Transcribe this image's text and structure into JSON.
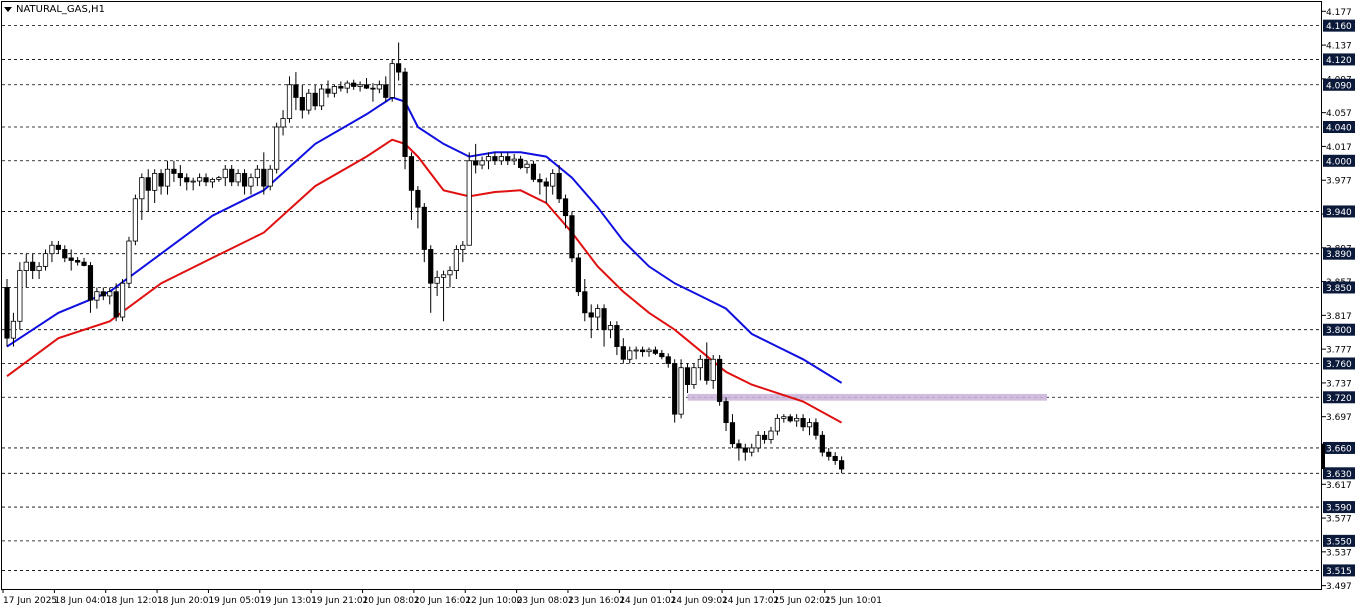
{
  "chart_data": {
    "type": "candlestick",
    "title": "NATURAL_GAS,H1",
    "ylim": [
      3.493,
      4.188
    ],
    "y_ticks": [
      "4.177",
      "4.137",
      "4.097",
      "4.057",
      "4.017",
      "3.977",
      "3.937",
      "3.897",
      "3.857",
      "3.817",
      "3.777",
      "3.737",
      "3.697",
      "3.657",
      "3.617",
      "3.577",
      "3.537",
      "3.497"
    ],
    "level_lines": [
      {
        "value": 4.16,
        "label": "4.160"
      },
      {
        "value": 4.12,
        "label": "4.120"
      },
      {
        "value": 4.09,
        "label": "4.090"
      },
      {
        "value": 4.04,
        "label": "4.040"
      },
      {
        "value": 4.0,
        "label": "4.000"
      },
      {
        "value": 3.94,
        "label": "3.940"
      },
      {
        "value": 3.89,
        "label": "3.890"
      },
      {
        "value": 3.85,
        "label": "3.850"
      },
      {
        "value": 3.8,
        "label": "3.800"
      },
      {
        "value": 3.76,
        "label": "3.760"
      },
      {
        "value": 3.72,
        "label": "3.720"
      },
      {
        "value": 3.66,
        "label": "3.660"
      },
      {
        "value": 3.63,
        "label": "3.630"
      },
      {
        "value": 3.59,
        "label": "3.590"
      },
      {
        "value": 3.55,
        "label": "3.550"
      },
      {
        "value": 3.515,
        "label": "3.515"
      }
    ],
    "zone": {
      "from": 3.716,
      "to": 3.724,
      "x_start": 106,
      "x_end": 162,
      "color": "#c9b3d9"
    },
    "x_labels": [
      {
        "i": 0,
        "label": "17 Jun 2025"
      },
      {
        "i": 8,
        "label": "18 Jun 04:01"
      },
      {
        "i": 16,
        "label": "18 Jun 12:01"
      },
      {
        "i": 24,
        "label": "18 Jun 20:01"
      },
      {
        "i": 32,
        "label": "19 Jun 05:01"
      },
      {
        "i": 40,
        "label": "19 Jun 13:01"
      },
      {
        "i": 48,
        "label": "19 Jun 21:01"
      },
      {
        "i": 56,
        "label": "20 Jun 08:01"
      },
      {
        "i": 64,
        "label": "20 Jun 16:01"
      },
      {
        "i": 72,
        "label": "22 Jun 10:00"
      },
      {
        "i": 80,
        "label": "23 Jun 08:01"
      },
      {
        "i": 88,
        "label": "23 Jun 16:01"
      },
      {
        "i": 96,
        "label": "24 Jun 01:01"
      },
      {
        "i": 104,
        "label": "24 Jun 09:01"
      },
      {
        "i": 112,
        "label": "24 Jun 17:01"
      },
      {
        "i": 120,
        "label": "25 Jun 02:01"
      },
      {
        "i": 128,
        "label": "25 Jun 10:01"
      }
    ],
    "candles": [
      [
        3.85,
        3.86,
        3.78,
        3.79
      ],
      [
        3.79,
        3.82,
        3.78,
        3.81
      ],
      [
        3.81,
        3.88,
        3.8,
        3.87
      ],
      [
        3.87,
        3.89,
        3.85,
        3.88
      ],
      [
        3.88,
        3.89,
        3.86,
        3.87
      ],
      [
        3.87,
        3.88,
        3.86,
        3.875
      ],
      [
        3.875,
        3.895,
        3.87,
        3.89
      ],
      [
        3.89,
        3.905,
        3.88,
        3.9
      ],
      [
        3.9,
        3.905,
        3.89,
        3.895
      ],
      [
        3.895,
        3.9,
        3.88,
        3.885
      ],
      [
        3.885,
        3.895,
        3.87,
        3.882
      ],
      [
        3.882,
        3.886,
        3.876,
        3.88
      ],
      [
        3.88,
        3.885,
        3.875,
        3.876
      ],
      [
        3.876,
        3.88,
        3.82,
        3.835
      ],
      [
        3.835,
        3.85,
        3.825,
        3.845
      ],
      [
        3.845,
        3.85,
        3.835,
        3.84
      ],
      [
        3.84,
        3.85,
        3.83,
        3.845
      ],
      [
        3.845,
        3.855,
        3.81,
        3.815
      ],
      [
        3.815,
        3.86,
        3.81,
        3.855
      ],
      [
        3.855,
        3.91,
        3.85,
        3.905
      ],
      [
        3.905,
        3.96,
        3.9,
        3.955
      ],
      [
        3.955,
        3.985,
        3.93,
        3.98
      ],
      [
        3.98,
        3.99,
        3.94,
        3.965
      ],
      [
        3.965,
        3.99,
        3.95,
        3.985
      ],
      [
        3.985,
        3.99,
        3.96,
        3.97
      ],
      [
        3.97,
        4,
        3.96,
        3.99
      ],
      [
        3.99,
        4,
        3.975,
        3.985
      ],
      [
        3.985,
        3.995,
        3.97,
        3.98
      ],
      [
        3.98,
        3.985,
        3.965,
        3.975
      ],
      [
        3.975,
        3.98,
        3.965,
        3.976
      ],
      [
        3.976,
        3.985,
        3.97,
        3.98
      ],
      [
        3.98,
        3.985,
        3.97,
        3.975
      ],
      [
        3.975,
        3.98,
        3.968,
        3.978
      ],
      [
        3.978,
        3.982,
        3.975,
        3.98
      ],
      [
        3.98,
        3.995,
        3.97,
        3.99
      ],
      [
        3.99,
        3.995,
        3.97,
        3.975
      ],
      [
        3.975,
        3.99,
        3.97,
        3.985
      ],
      [
        3.985,
        3.99,
        3.96,
        3.97
      ],
      [
        3.97,
        3.985,
        3.96,
        3.98
      ],
      [
        3.98,
        3.995,
        3.97,
        3.99
      ],
      [
        3.99,
        4.01,
        3.96,
        3.97
      ],
      [
        3.97,
        3.995,
        3.965,
        3.99
      ],
      [
        3.99,
        4.045,
        3.985,
        4.04
      ],
      [
        4.04,
        4.06,
        4.03,
        4.05
      ],
      [
        4.05,
        4.1,
        4.045,
        4.09
      ],
      [
        4.09,
        4.105,
        4.06,
        4.075
      ],
      [
        4.075,
        4.09,
        4.05,
        4.06
      ],
      [
        4.06,
        4.085,
        4.055,
        4.08
      ],
      [
        4.08,
        4.09,
        4.06,
        4.065
      ],
      [
        4.065,
        4.09,
        4.06,
        4.085
      ],
      [
        4.085,
        4.095,
        4.075,
        4.08
      ],
      [
        4.08,
        4.09,
        4.075,
        4.088
      ],
      [
        4.088,
        4.094,
        4.082,
        4.086
      ],
      [
        4.086,
        4.095,
        4.08,
        4.092
      ],
      [
        4.092,
        4.096,
        4.084,
        4.088
      ],
      [
        4.088,
        4.094,
        4.082,
        4.09
      ],
      [
        4.09,
        4.098,
        4.085,
        4.086
      ],
      [
        4.086,
        4.092,
        4.07,
        4.085
      ],
      [
        4.085,
        4.095,
        4.08,
        4.09
      ],
      [
        4.09,
        4.1,
        4.07,
        4.075
      ],
      [
        4.075,
        4.12,
        4.07,
        4.115
      ],
      [
        4.115,
        4.14,
        4.095,
        4.105
      ],
      [
        4.105,
        4.11,
        3.99,
        4.005
      ],
      [
        4.005,
        4.01,
        3.93,
        3.965
      ],
      [
        3.965,
        3.97,
        3.92,
        3.945
      ],
      [
        3.945,
        3.95,
        3.88,
        3.895
      ],
      [
        3.895,
        3.9,
        3.82,
        3.855
      ],
      [
        3.855,
        3.87,
        3.84,
        3.862
      ],
      [
        3.862,
        3.87,
        3.81,
        3.865
      ],
      [
        3.865,
        3.875,
        3.85,
        3.87
      ],
      [
        3.87,
        3.9,
        3.86,
        3.895
      ],
      [
        3.895,
        3.905,
        3.88,
        3.9
      ],
      [
        3.9,
        4.01,
        3.98,
        4.0
      ],
      [
        4.0,
        4.02,
        3.985,
        3.995
      ],
      [
        3.995,
        4.005,
        3.99,
        4.0
      ],
      [
        4.0,
        4.01,
        3.99,
        4.005
      ],
      [
        4.005,
        4.01,
        3.995,
        4.0
      ],
      [
        4.0,
        4.01,
        3.995,
        4.005
      ],
      [
        4.005,
        4.01,
        3.995,
        4.0
      ],
      [
        4.0,
        4.008,
        3.995,
        4.002
      ],
      [
        4.002,
        4.006,
        3.99,
        3.992
      ],
      [
        3.992,
        4.0,
        3.985,
        3.996
      ],
      [
        3.996,
        4.0,
        3.975,
        3.978
      ],
      [
        3.978,
        3.985,
        3.96,
        3.975
      ],
      [
        3.975,
        3.98,
        3.95,
        3.97
      ],
      [
        3.97,
        3.99,
        3.96,
        3.985
      ],
      [
        3.985,
        3.995,
        3.95,
        3.955
      ],
      [
        3.955,
        3.96,
        3.92,
        3.935
      ],
      [
        3.935,
        3.94,
        3.88,
        3.885
      ],
      [
        3.885,
        3.89,
        3.84,
        3.845
      ],
      [
        3.845,
        3.86,
        3.81,
        3.82
      ],
      [
        3.82,
        3.83,
        3.79,
        3.815
      ],
      [
        3.815,
        3.83,
        3.8,
        3.825
      ],
      [
        3.825,
        3.83,
        3.78,
        3.8
      ],
      [
        3.8,
        3.81,
        3.79,
        3.805
      ],
      [
        3.805,
        3.81,
        3.77,
        3.78
      ],
      [
        3.78,
        3.79,
        3.76,
        3.765
      ],
      [
        3.765,
        3.78,
        3.76,
        3.775
      ],
      [
        3.775,
        3.78,
        3.765,
        3.776
      ],
      [
        3.776,
        3.78,
        3.768,
        3.774
      ],
      [
        3.774,
        3.779,
        3.768,
        3.776
      ],
      [
        3.776,
        3.78,
        3.77,
        3.772
      ],
      [
        3.772,
        3.776,
        3.765,
        3.768
      ],
      [
        3.768,
        3.772,
        3.755,
        3.76
      ],
      [
        3.76,
        3.765,
        3.69,
        3.7
      ],
      [
        3.7,
        3.765,
        3.695,
        3.755
      ],
      [
        3.755,
        3.76,
        3.725,
        3.735
      ],
      [
        3.735,
        3.76,
        3.73,
        3.755
      ],
      [
        3.755,
        3.77,
        3.74,
        3.765
      ],
      [
        3.765,
        3.785,
        3.735,
        3.74
      ],
      [
        3.74,
        3.77,
        3.73,
        3.765
      ],
      [
        3.765,
        3.77,
        3.71,
        3.715
      ],
      [
        3.715,
        3.72,
        3.68,
        3.69
      ],
      [
        3.69,
        3.7,
        3.66,
        3.665
      ],
      [
        3.665,
        3.67,
        3.645,
        3.66
      ],
      [
        3.66,
        3.665,
        3.645,
        3.655
      ],
      [
        3.655,
        3.665,
        3.65,
        3.66
      ],
      [
        3.66,
        3.68,
        3.655,
        3.675
      ],
      [
        3.675,
        3.68,
        3.665,
        3.67
      ],
      [
        3.67,
        3.685,
        3.665,
        3.68
      ],
      [
        3.68,
        3.7,
        3.675,
        3.695
      ],
      [
        3.695,
        3.7,
        3.69,
        3.697
      ],
      [
        3.697,
        3.7,
        3.69,
        3.692
      ],
      [
        3.692,
        3.7,
        3.685,
        3.695
      ],
      [
        3.695,
        3.7,
        3.68,
        3.685
      ],
      [
        3.685,
        3.695,
        3.675,
        3.69
      ],
      [
        3.69,
        3.695,
        3.67,
        3.675
      ],
      [
        3.675,
        3.68,
        3.65,
        3.655
      ],
      [
        3.655,
        3.66,
        3.645,
        3.65
      ],
      [
        3.65,
        3.655,
        3.64,
        3.645
      ],
      [
        3.645,
        3.65,
        3.63,
        3.635
      ]
    ],
    "ma_blue": {
      "color": "#1010e0",
      "points": [
        [
          0,
          3.78
        ],
        [
          8,
          3.82
        ],
        [
          16,
          3.845
        ],
        [
          24,
          3.89
        ],
        [
          32,
          3.935
        ],
        [
          40,
          3.965
        ],
        [
          48,
          4.02
        ],
        [
          56,
          4.055
        ],
        [
          60,
          4.075
        ],
        [
          62,
          4.07
        ],
        [
          64,
          4.04
        ],
        [
          68,
          4.02
        ],
        [
          72,
          4.005
        ],
        [
          76,
          4.01
        ],
        [
          80,
          4.01
        ],
        [
          84,
          4.005
        ],
        [
          88,
          3.98
        ],
        [
          92,
          3.945
        ],
        [
          96,
          3.905
        ],
        [
          100,
          3.875
        ],
        [
          104,
          3.855
        ],
        [
          108,
          3.84
        ],
        [
          112,
          3.825
        ],
        [
          116,
          3.795
        ],
        [
          120,
          3.78
        ],
        [
          124,
          3.765
        ],
        [
          130,
          3.737
        ]
      ]
    },
    "ma_red": {
      "color": "#e01010",
      "points": [
        [
          0,
          3.745
        ],
        [
          8,
          3.79
        ],
        [
          16,
          3.81
        ],
        [
          24,
          3.855
        ],
        [
          32,
          3.885
        ],
        [
          40,
          3.915
        ],
        [
          48,
          3.97
        ],
        [
          56,
          4.005
        ],
        [
          60,
          4.025
        ],
        [
          62,
          4.02
        ],
        [
          64,
          4.005
        ],
        [
          68,
          3.965
        ],
        [
          72,
          3.958
        ],
        [
          76,
          3.963
        ],
        [
          80,
          3.965
        ],
        [
          84,
          3.95
        ],
        [
          88,
          3.915
        ],
        [
          92,
          3.875
        ],
        [
          96,
          3.845
        ],
        [
          100,
          3.82
        ],
        [
          104,
          3.8
        ],
        [
          108,
          3.775
        ],
        [
          112,
          3.75
        ],
        [
          116,
          3.735
        ],
        [
          120,
          3.725
        ],
        [
          124,
          3.715
        ],
        [
          130,
          3.69
        ]
      ]
    }
  }
}
